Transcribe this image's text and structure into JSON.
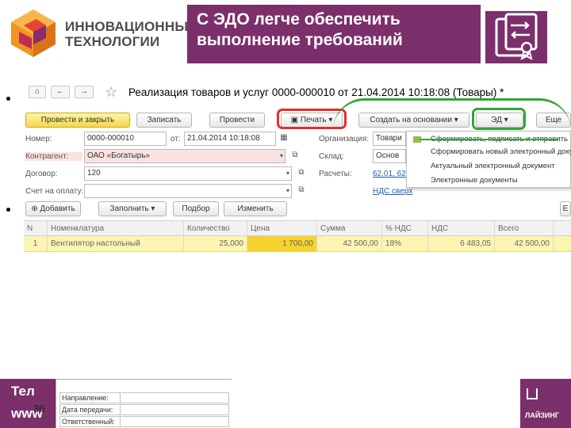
{
  "header": {
    "logo_line1": "ИННОВАЦИОННЫЕ",
    "logo_line2": "ТЕХНОЛОГИИ",
    "slide_title_line1": "С ЭДО легче обеспечить",
    "slide_title_line2": "выполнение требований",
    "logo_icon": "cube-icon",
    "edo_icon": "document-exchange-icon"
  },
  "colors": {
    "brand_purple": "#7b2f6b",
    "primary_button": "#f5d84a",
    "highlight_red": "#e03030",
    "highlight_green": "#35a43a"
  },
  "window": {
    "nav_back": "←",
    "nav_forward": "→",
    "star_icon": "star-icon",
    "doc_title": "Реализация товаров и услуг 0000-000010 от 21.04.2014 10:18:08 (Товары) *",
    "toolbar": {
      "post_close": "Провести и закрыть",
      "save": "Записать",
      "post": "Провести",
      "print": "Печать",
      "create_based": "Создать на основании",
      "ed": "ЭД",
      "more": "Еще"
    },
    "fields": {
      "number_label": "Номер:",
      "number_value": "0000-000010",
      "date_prefix": "от:",
      "date_value": "21.04.2014 10:18:08",
      "org_label": "Организация:",
      "org_value": "Товари",
      "contractor_label": "Контрагент:",
      "contractor_value": "ОАО «Богатырь»",
      "warehouse_label": "Склад:",
      "warehouse_value": "Основ",
      "contract_label": "Договор:",
      "contract_value": "120",
      "settlements_label": "Расчеты:",
      "settlements_link": "62.01, 62",
      "invoice_label": "Счет на оплату:",
      "vat_link": "НДС сверх"
    },
    "dropdown": {
      "item1": "Сформировать, подписать и отправить",
      "item2": "Сформировать новый электронный документ",
      "item3": "Актуальный электронный документ",
      "item4": "Электронные документы"
    },
    "table_toolbar": {
      "add": "Добавить",
      "fill": "Заполнить",
      "pick": "Подбор",
      "change": "Изменить"
    },
    "table": {
      "headers": [
        "N",
        "Номенклатура",
        "Количество",
        "Цена",
        "Сумма",
        "% НДС",
        "НДС",
        "Всего"
      ],
      "rows": [
        [
          "1",
          "Вентилятор настольный",
          "25,000",
          "1 700,00",
          "42 500,00",
          "18%",
          "6 483,05",
          "42 500,00"
        ]
      ]
    }
  },
  "footer": {
    "left_line1": "Тел",
    "left_line2": "www",
    "page_number": "36",
    "right_text": "ЛАЙЗИНГ",
    "subform_rows": [
      "Направление:",
      "Дата передачи:",
      "Ответственный:"
    ]
  }
}
